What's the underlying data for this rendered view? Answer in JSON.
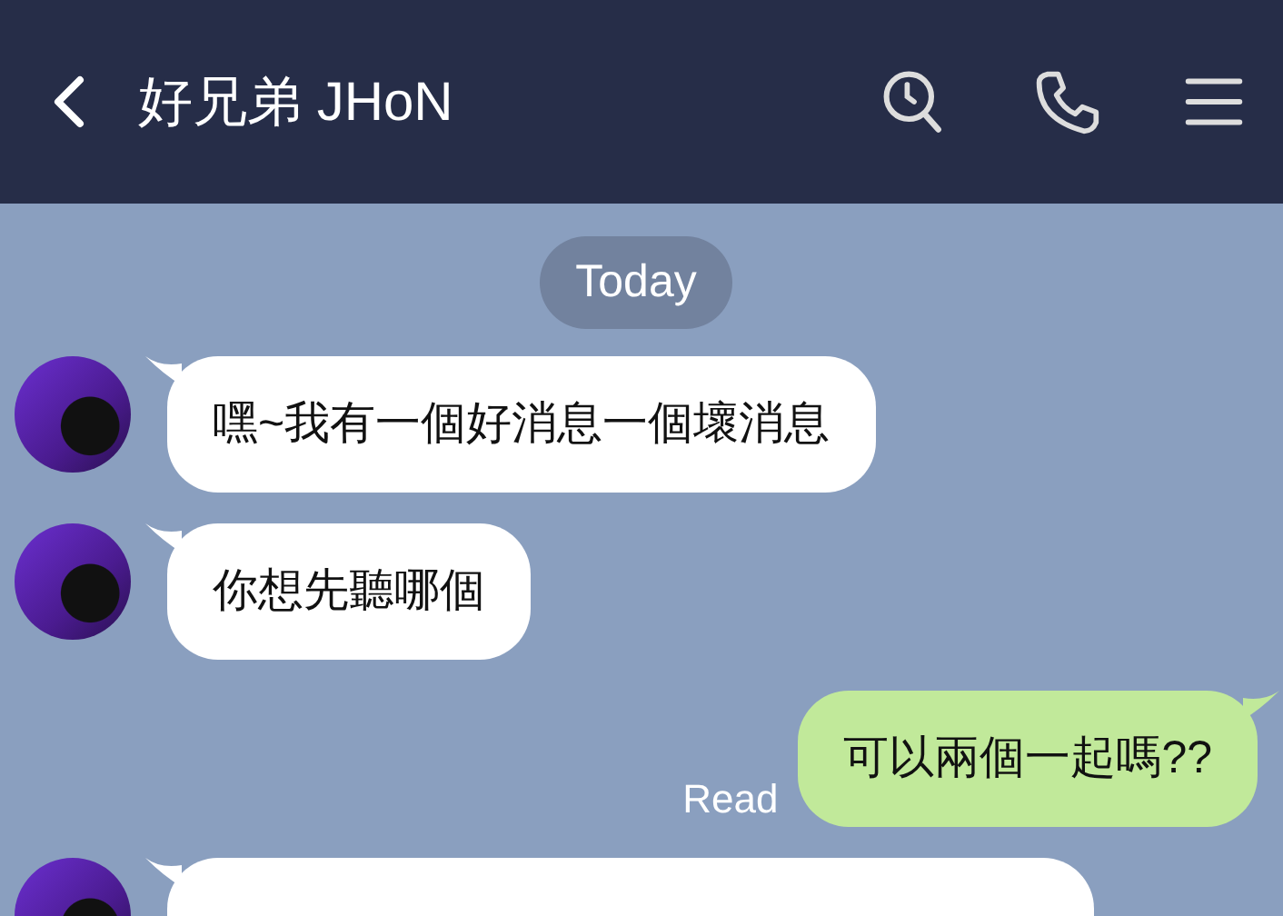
{
  "header": {
    "title": "好兄弟 JHoN"
  },
  "date_label": "Today",
  "messages": [
    {
      "kind": "received",
      "text": "嘿~我有一個好消息一個壞消息"
    },
    {
      "kind": "received",
      "text": "你想先聽哪個"
    },
    {
      "kind": "sent",
      "text": "可以兩個一起嗎??",
      "status": "Read"
    },
    {
      "kind": "received"
    }
  ]
}
